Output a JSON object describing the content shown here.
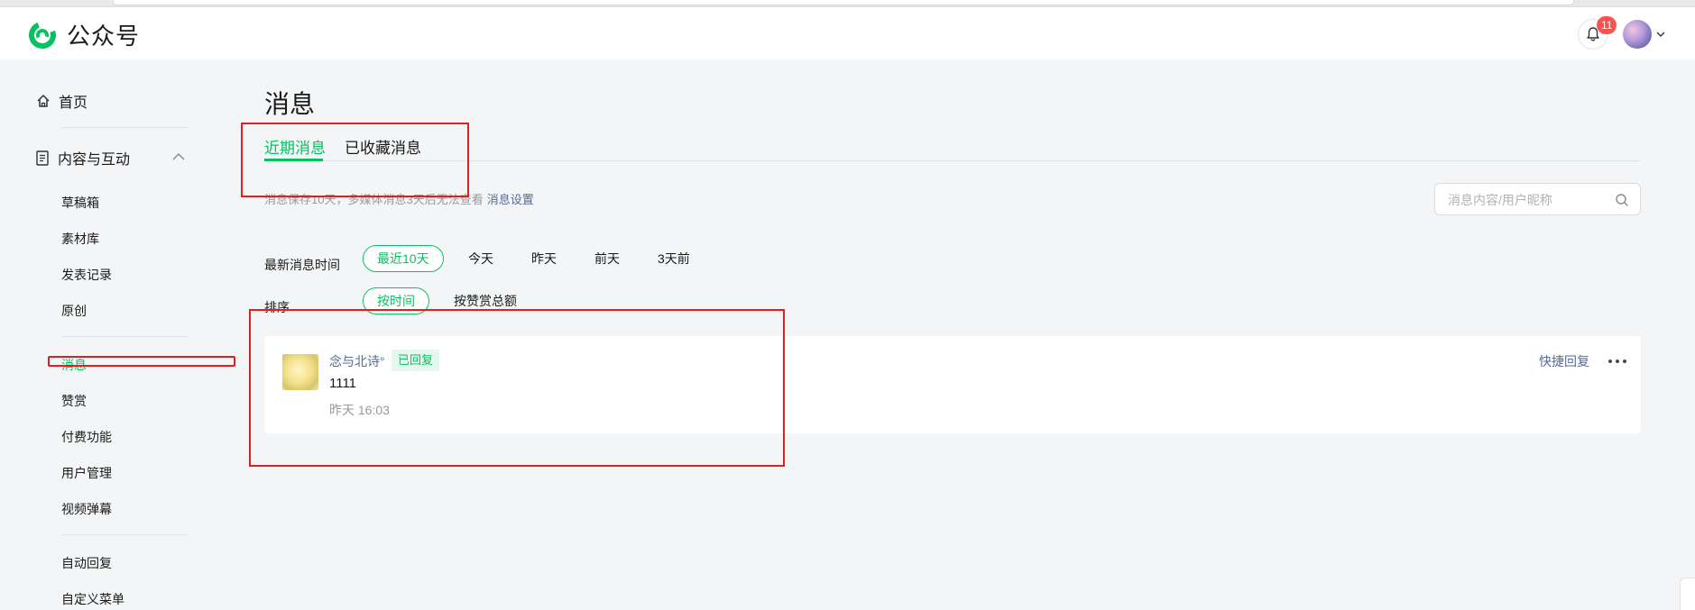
{
  "app": {
    "title": "公众号",
    "brand_color": "#07c160"
  },
  "header": {
    "notification_count": "11",
    "icons": [
      "bell-icon",
      "avatar",
      "chevron-down-icon"
    ]
  },
  "sidebar": {
    "home": "首页",
    "group": {
      "label": "内容与互动",
      "expanded": true
    },
    "items": [
      {
        "label": "草稿箱"
      },
      {
        "label": "素材库"
      },
      {
        "label": "发表记录"
      },
      {
        "label": "原创"
      },
      {
        "label": "消息",
        "active": true
      },
      {
        "label": "赞赏"
      },
      {
        "label": "付费功能"
      },
      {
        "label": "用户管理"
      },
      {
        "label": "视频弹幕"
      },
      {
        "label": "自动回复"
      },
      {
        "label": "自定义菜单"
      }
    ]
  },
  "main": {
    "title": "消息",
    "tabs": [
      {
        "label": "近期消息",
        "active": true
      },
      {
        "label": "已收藏消息"
      }
    ],
    "tip": "消息保存10天，多媒体消息3天后无法查看",
    "tip_link": "消息设置",
    "search": {
      "placeholder": "消息内容/用户昵称",
      "value": ""
    },
    "filters": {
      "time_label": "最新消息时间",
      "time_options": [
        "最近10天",
        "今天",
        "昨天",
        "前天",
        "3天前"
      ],
      "time_selected": "最近10天",
      "sort_label": "排序",
      "sort_options": [
        "按时间",
        "按赞赏总额"
      ],
      "sort_selected": "按时间"
    },
    "messages": [
      {
        "nickname": "念与北诗°",
        "status": "已回复",
        "content": "1111",
        "time": "昨天 16:03",
        "quick_reply": "快捷回复"
      }
    ]
  }
}
